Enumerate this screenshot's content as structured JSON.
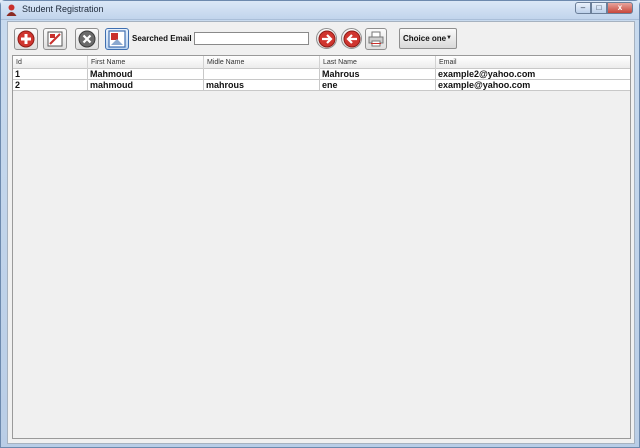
{
  "window": {
    "title": "Student Registration",
    "controls": {
      "minimize": "–",
      "maximize": "□",
      "close": "x"
    }
  },
  "toolbar": {
    "add_icon": "plus-circle-icon",
    "edit_icon": "edit-icon",
    "delete_icon": "x-circle-icon",
    "image_icon": "picture-icon",
    "search_label": "Searched Email",
    "search_value": "",
    "next_icon": "arrow-right-circle-icon",
    "prev_icon": "arrow-left-circle-icon",
    "print_icon": "printer-icon",
    "choice_selected": "Choice one",
    "choice_arrow": "▼"
  },
  "table": {
    "columns": [
      "Id",
      "First Name",
      "Midle Name",
      "Last Name",
      "Email"
    ],
    "rows": [
      [
        "1",
        "Mahmoud",
        "",
        "Mahrous",
        "example2@yahoo.com"
      ],
      [
        "2",
        "mahmoud",
        "mahrous",
        "ene",
        "example@yahoo.com"
      ]
    ]
  },
  "colors": {
    "accent_red": "#c9302c",
    "window_frame": "#b9cde6",
    "client_bg": "#f0f0f0"
  }
}
